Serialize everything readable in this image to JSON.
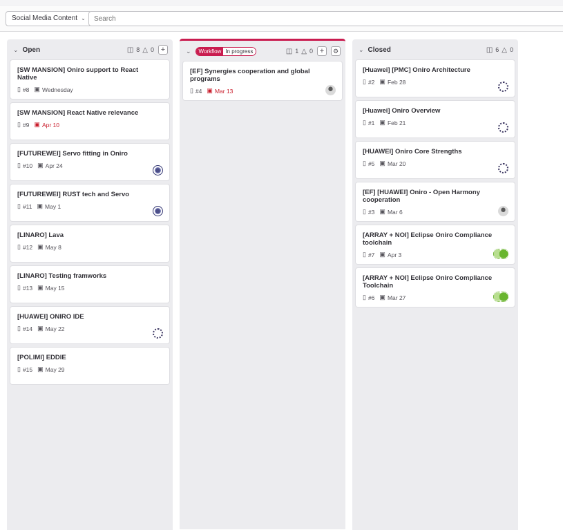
{
  "toolbar": {
    "board_name": "Social Media Content",
    "search_placeholder": "Search"
  },
  "colors": {
    "accent": "#c91c4f",
    "overdue": "#c91c2b"
  },
  "icons": {
    "issue": "issue-icon",
    "calendar": "calendar-icon",
    "weight": "weight-icon",
    "chevron": "chevron-down-icon",
    "add": "plus-icon",
    "settings": "gear-icon"
  },
  "lists": [
    {
      "title": "Open",
      "issue_count": "8",
      "weight": "0",
      "cards": [
        {
          "title": "[SW MANSION] Oniro support to React Native",
          "ref": "#8",
          "due": "Wednesday",
          "overdue": false,
          "avatar": ""
        },
        {
          "title": "[SW MANSION] React Native relevance",
          "ref": "#9",
          "due": "Apr 10",
          "overdue": true,
          "avatar": ""
        },
        {
          "title": "[FUTUREWEI] Servo fitting in Oniro",
          "ref": "#10",
          "due": "Apr 24",
          "overdue": false,
          "avatar": "globe"
        },
        {
          "title": "[FUTUREWEI] RUST tech and Servo",
          "ref": "#11",
          "due": "May 1",
          "overdue": false,
          "avatar": "globe"
        },
        {
          "title": "[LINARO] Lava",
          "ref": "#12",
          "due": "May 8",
          "overdue": false,
          "avatar": ""
        },
        {
          "title": "[LINARO] Testing framworks",
          "ref": "#13",
          "due": "May 15",
          "overdue": false,
          "avatar": ""
        },
        {
          "title": "[HUAWEI] ONIRO IDE",
          "ref": "#14",
          "due": "May 22",
          "overdue": false,
          "avatar": "gear"
        },
        {
          "title": "[POLIMI] EDDIE",
          "ref": "#15",
          "due": "May 29",
          "overdue": false,
          "avatar": ""
        }
      ]
    },
    {
      "label_key": "Workflow",
      "label_value": "In progress",
      "issue_count": "1",
      "weight": "0",
      "cards": [
        {
          "title": "[EF] Synergies cooperation and global programs",
          "ref": "#4",
          "due": "Mar 13",
          "overdue": true,
          "avatar": "person"
        }
      ]
    },
    {
      "title": "Closed",
      "issue_count": "6",
      "weight": "0",
      "cards": [
        {
          "title": "[Huawei] [PMC] Oniro Architecture",
          "ref": "#2",
          "due": "Feb 28",
          "overdue": false,
          "avatar": "gear"
        },
        {
          "title": "[Huawei] Oniro Overview",
          "ref": "#1",
          "due": "Feb 21",
          "overdue": false,
          "avatar": "gear"
        },
        {
          "title": "[HUAWEI] Oniro Core Strengths",
          "ref": "#5",
          "due": "Mar 20",
          "overdue": false,
          "avatar": "gear"
        },
        {
          "title": "[EF] [HUAWEI] Oniro - Open Harmony cooperation",
          "ref": "#3",
          "due": "Mar 6",
          "overdue": false,
          "avatar": "person"
        },
        {
          "title": "[ARRAY + NOI] Eclipse Oniro Compliance toolchain",
          "ref": "#7",
          "due": "Apr 3",
          "overdue": false,
          "avatar": "green"
        },
        {
          "title": "[ARRAY + NOI] Eclipse Oniro Compliance Toolchain",
          "ref": "#6",
          "due": "Mar 27",
          "overdue": false,
          "avatar": "green"
        }
      ]
    }
  ]
}
